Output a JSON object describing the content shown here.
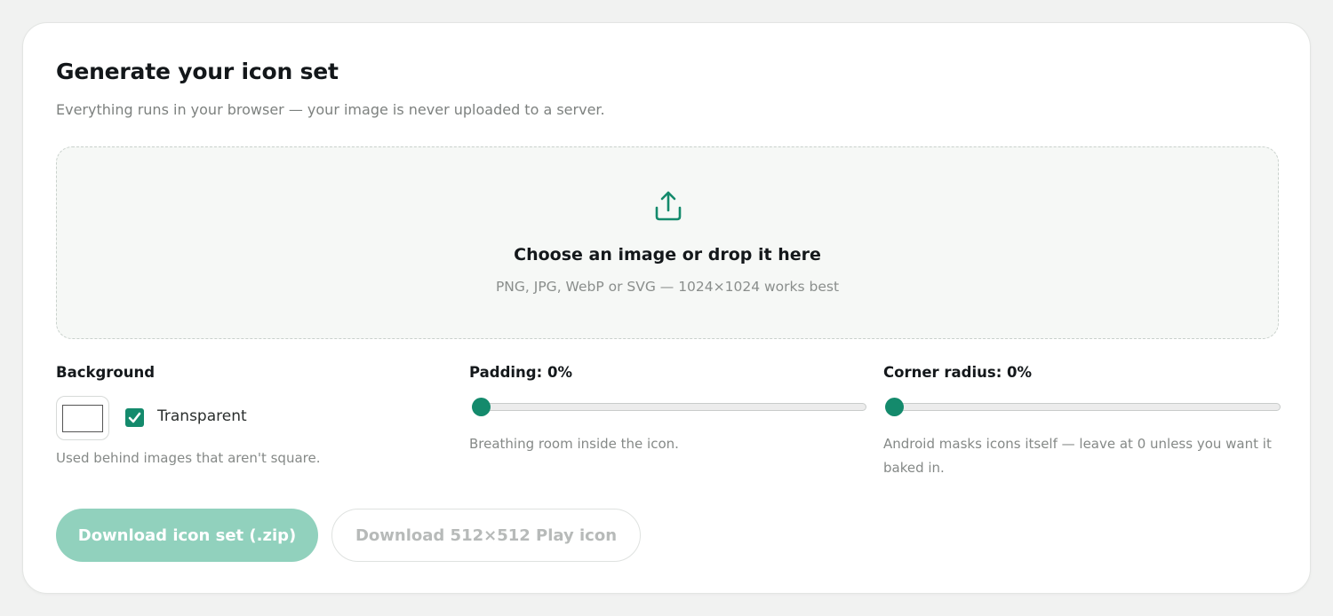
{
  "header": {
    "title": "Generate your icon set",
    "subtitle": "Everything runs in your browser — your image is never uploaded to a server."
  },
  "dropzone": {
    "icon": "upload-icon",
    "title": "Choose an image or drop it here",
    "subtitle": "PNG, JPG, WebP or SVG — 1024×1024 works best"
  },
  "background": {
    "label": "Background",
    "swatch_color": "#ffffff",
    "transparent_label": "Transparent",
    "transparent_checked": true,
    "help": "Used behind images that aren't square."
  },
  "padding": {
    "label": "Padding: 0%",
    "value_percent": 0,
    "help": "Breathing room inside the icon."
  },
  "corner_radius": {
    "label": "Corner radius: 0%",
    "value_percent": 0,
    "help_line1": "Android masks icons itself — leave at 0 unless you want it",
    "help_line2": "baked in."
  },
  "actions": {
    "download_zip": "Download icon set (.zip)",
    "download_play": "Download 512×512 Play icon"
  },
  "colors": {
    "accent": "#148a6c",
    "primary_button_disabled": "#91d1bd"
  }
}
